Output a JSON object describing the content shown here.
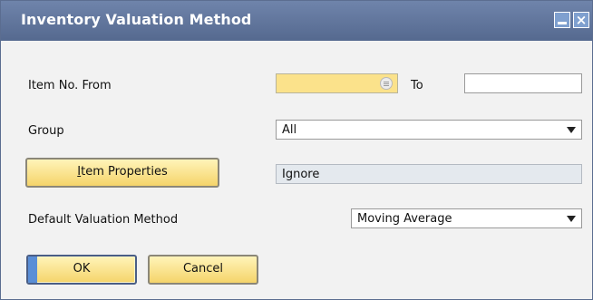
{
  "window": {
    "title": "Inventory Valuation Method"
  },
  "form": {
    "item_no_from_label": "Item No. From",
    "item_no_from_value": "",
    "to_label": "To",
    "to_value": "",
    "group_label": "Group",
    "group_value": "All",
    "item_properties_button_first_letter": "I",
    "item_properties_button_rest": "tem Properties",
    "item_properties_value": "Ignore",
    "default_method_label": "Default Valuation Method",
    "default_method_value": "Moving Average"
  },
  "buttons": {
    "ok": "OK",
    "cancel": "Cancel"
  },
  "icons": {
    "minimize": "minimize-icon",
    "close": "close-icon",
    "lookup": "lookup-icon",
    "dropdown": "chevron-down-icon"
  },
  "colors": {
    "titlebar": "#5f7399",
    "required_field": "#fbe28b",
    "button": "#f7d970",
    "readonly_field": "#e4e9ee"
  }
}
